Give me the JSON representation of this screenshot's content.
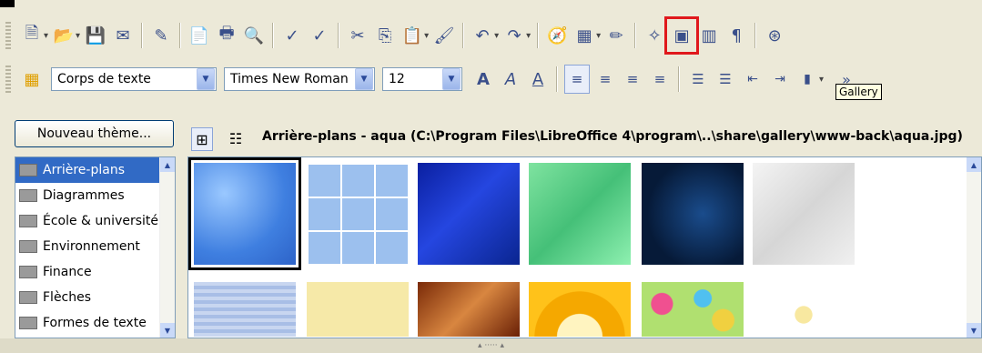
{
  "toolbar1": {
    "buttons": [
      {
        "icon": "new-document-icon",
        "label": "🗎"
      },
      {
        "icon": "open-icon",
        "label": "📂"
      },
      {
        "icon": "save-icon",
        "label": "💾"
      },
      {
        "icon": "email-icon",
        "label": "✉"
      },
      {
        "icon": "edit-file-icon",
        "label": "✎"
      },
      {
        "icon": "export-pdf-icon",
        "label": "📄"
      },
      {
        "icon": "print-icon",
        "label": "🖶"
      },
      {
        "icon": "print-preview-icon",
        "label": "🔍"
      },
      {
        "icon": "spellcheck-icon",
        "label": "✓"
      },
      {
        "icon": "autospell-icon",
        "label": "✓"
      },
      {
        "icon": "cut-icon",
        "label": "✂"
      },
      {
        "icon": "copy-icon",
        "label": "⎘"
      },
      {
        "icon": "paste-icon",
        "label": "📋"
      },
      {
        "icon": "format-paintbrush-icon",
        "label": "🖌"
      },
      {
        "icon": "undo-icon",
        "label": "↶"
      },
      {
        "icon": "redo-icon",
        "label": "↷"
      },
      {
        "icon": "navigator-icon",
        "label": "🧭"
      },
      {
        "icon": "table-icon",
        "label": "▦"
      },
      {
        "icon": "draw-functions-icon",
        "label": "✏"
      },
      {
        "icon": "star-navigator-icon",
        "label": "✧"
      },
      {
        "icon": "gallery-icon",
        "label": "▣"
      },
      {
        "icon": "data-sources-icon",
        "label": "▥"
      },
      {
        "icon": "formatting-marks-icon",
        "label": "¶"
      },
      {
        "icon": "help-icon",
        "label": "⊛"
      }
    ],
    "tooltip": "Gallery"
  },
  "toolbar2": {
    "style_value": "Corps de texte",
    "font_value": "Times New Roman",
    "size_value": "12",
    "more_label": "»"
  },
  "gallery": {
    "new_theme_label": "Nouveau thème...",
    "path": "Arrière-plans - aqua (C:\\Program Files\\LibreOffice 4\\program\\..\\share\\gallery\\www-back\\aqua.jpg)",
    "themes": [
      "Arrière-plans",
      "Diagrammes",
      "École & université",
      "Environnement",
      "Finance",
      "Flèches",
      "Formes de texte"
    ],
    "colors": {
      "selection": "#316ac5",
      "highlight": "#e0181c"
    }
  }
}
